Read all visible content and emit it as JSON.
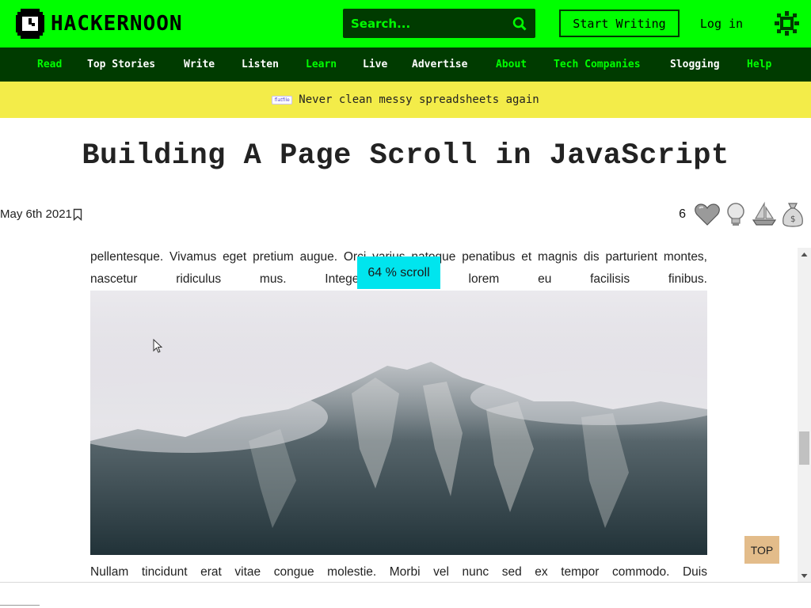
{
  "header": {
    "logo_text": "HACKERNOON",
    "search_placeholder": "Search...",
    "start_writing": "Start Writing",
    "login": "Log in",
    "brand_green": "#00ff00",
    "dark_green": "#003b00"
  },
  "nav": {
    "items": [
      {
        "label": "Read",
        "style": "green"
      },
      {
        "label": "Top Stories",
        "style": "white"
      },
      {
        "label": "Write",
        "style": "white"
      },
      {
        "label": "Listen",
        "style": "white"
      },
      {
        "label": "Learn",
        "style": "green"
      },
      {
        "label": "Live",
        "style": "white"
      },
      {
        "label": "Advertise",
        "style": "white"
      },
      {
        "label": "About",
        "style": "green"
      },
      {
        "label": "Tech Companies",
        "style": "green"
      },
      {
        "label": "Slogging",
        "style": "white"
      },
      {
        "label": "Help",
        "style": "green"
      }
    ]
  },
  "promo": {
    "badge": "flatfile",
    "text": "Never clean messy spreadsheets again",
    "background": "#f3ec49"
  },
  "article": {
    "title": "Building A Page Scroll in JavaScript",
    "date": "May 6th 2021",
    "reaction_count": "6",
    "reactions": [
      "heart-icon",
      "lightbulb-icon",
      "boat-icon",
      "money-bag-icon"
    ],
    "paragraph_before": "pellentesque. Vivamus eget pretium augue. Orci varius natoque penatibus et magnis dis parturient montes, nascetur ridiculus mus. Integer porta lorem eu facilisis finibus.",
    "paragraph_after": "Nullam tincidunt erat vitae congue molestie. Morbi vel nunc sed ex tempor commodo. Duis"
  },
  "scroll_indicator": {
    "text": "64 % scroll",
    "percent": 64,
    "color": "#00e5ee"
  },
  "top_button": {
    "label": "TOP",
    "color": "#e3bc8a"
  }
}
